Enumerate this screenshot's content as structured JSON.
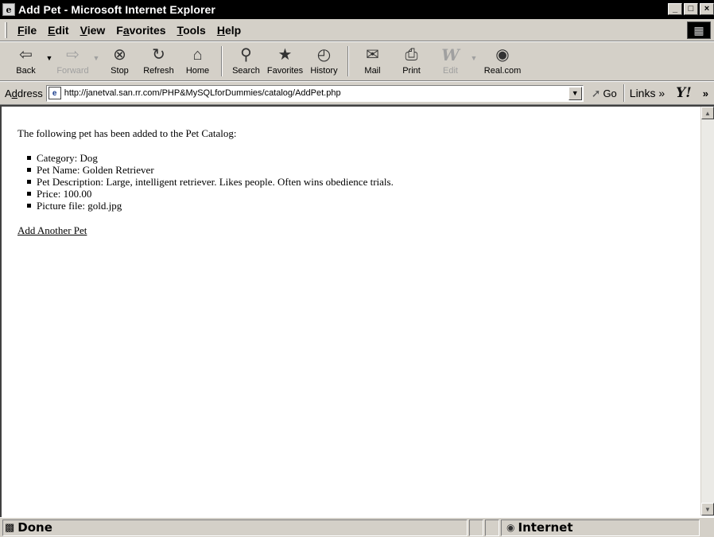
{
  "window": {
    "title": "Add Pet - Microsoft Internet Explorer",
    "minimize": "_",
    "maximize": "□",
    "close": "×"
  },
  "menu": {
    "items": [
      {
        "accel": "F",
        "rest": "ile"
      },
      {
        "accel": "E",
        "rest": "dit"
      },
      {
        "accel": "V",
        "rest": "iew"
      },
      {
        "pre": "F",
        "accel": "a",
        "rest": "vorites"
      },
      {
        "accel": "T",
        "rest": "ools"
      },
      {
        "accel": "H",
        "rest": "elp"
      }
    ]
  },
  "toolbar": {
    "back": "Back",
    "forward": "Forward",
    "stop": "Stop",
    "refresh": "Refresh",
    "home": "Home",
    "search": "Search",
    "favorites": "Favorites",
    "history": "History",
    "mail": "Mail",
    "print": "Print",
    "edit": "Edit",
    "realcom": "Real.com"
  },
  "address": {
    "label_pre": "A",
    "label_accel": "d",
    "label_rest": "dress",
    "url": "http://janetval.san.rr.com/PHP&MySQLforDummies/catalog/AddPet.php",
    "go": "Go",
    "links": "Links »"
  },
  "content": {
    "intro": "The following pet has been added to the Pet Catalog:",
    "items": [
      "Category: Dog",
      "Pet Name: Golden Retriever",
      "Pet Description: Large, intelligent retriever. Likes people. Often wins obedience trials.",
      "Price: 100.00",
      "Picture file: gold.jpg"
    ],
    "link": "Add Another Pet"
  },
  "status": {
    "text": "Done",
    "zone": "Internet"
  }
}
